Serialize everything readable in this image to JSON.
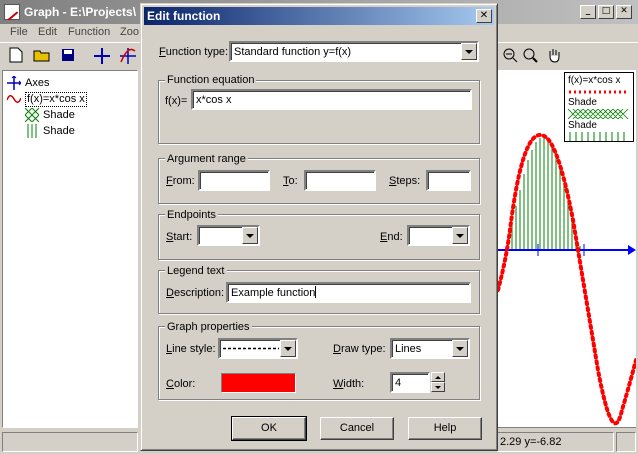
{
  "main_window": {
    "title": "Graph - E:\\Projects\\",
    "menu": [
      "File",
      "Edit",
      "Function",
      "Zoo"
    ],
    "tree": [
      {
        "label": "Axes",
        "icon": "axes-icon"
      },
      {
        "label": "f(x)=x*cos x",
        "icon": "function-curve-icon"
      },
      {
        "label": "Shade",
        "icon": "crosshatch-shade-icon"
      },
      {
        "label": "Shade",
        "icon": "vertical-shade-icon"
      }
    ],
    "legend": {
      "entries": [
        "f(x)=x*cos x",
        "Shade",
        "Shade"
      ]
    },
    "status": {
      "coords": "2.29  y=-6.82"
    },
    "colors": {
      "function_line": "#ff0000",
      "shade": "#008000",
      "axis": "#0000ff"
    }
  },
  "dialog": {
    "title": "Edit function",
    "function_type": {
      "label": "Function type:",
      "value": "Standard function   y=f(x)"
    },
    "equation_group": {
      "title": "Function equation",
      "prefix": "f(x)=",
      "value": "x*cos x"
    },
    "argument_group": {
      "title": "Argument range",
      "from_label": "From:",
      "from_value": "",
      "to_label": "To:",
      "to_value": "",
      "steps_label": "Steps:",
      "steps_value": ""
    },
    "endpoints_group": {
      "title": "Endpoints",
      "start_label": "Start:",
      "start_value": "",
      "end_label": "End:",
      "end_value": ""
    },
    "legend_group": {
      "title": "Legend text",
      "description_label": "Description:",
      "description_value": "Example function"
    },
    "graph_group": {
      "title": "Graph properties",
      "line_style_label": "Line style:",
      "draw_type_label": "Draw type:",
      "draw_type_value": "Lines",
      "color_label": "Color:",
      "color_value": "#ff0000",
      "width_label": "Width:",
      "width_value": "4"
    },
    "buttons": {
      "ok": "OK",
      "cancel": "Cancel",
      "help": "Help"
    }
  }
}
